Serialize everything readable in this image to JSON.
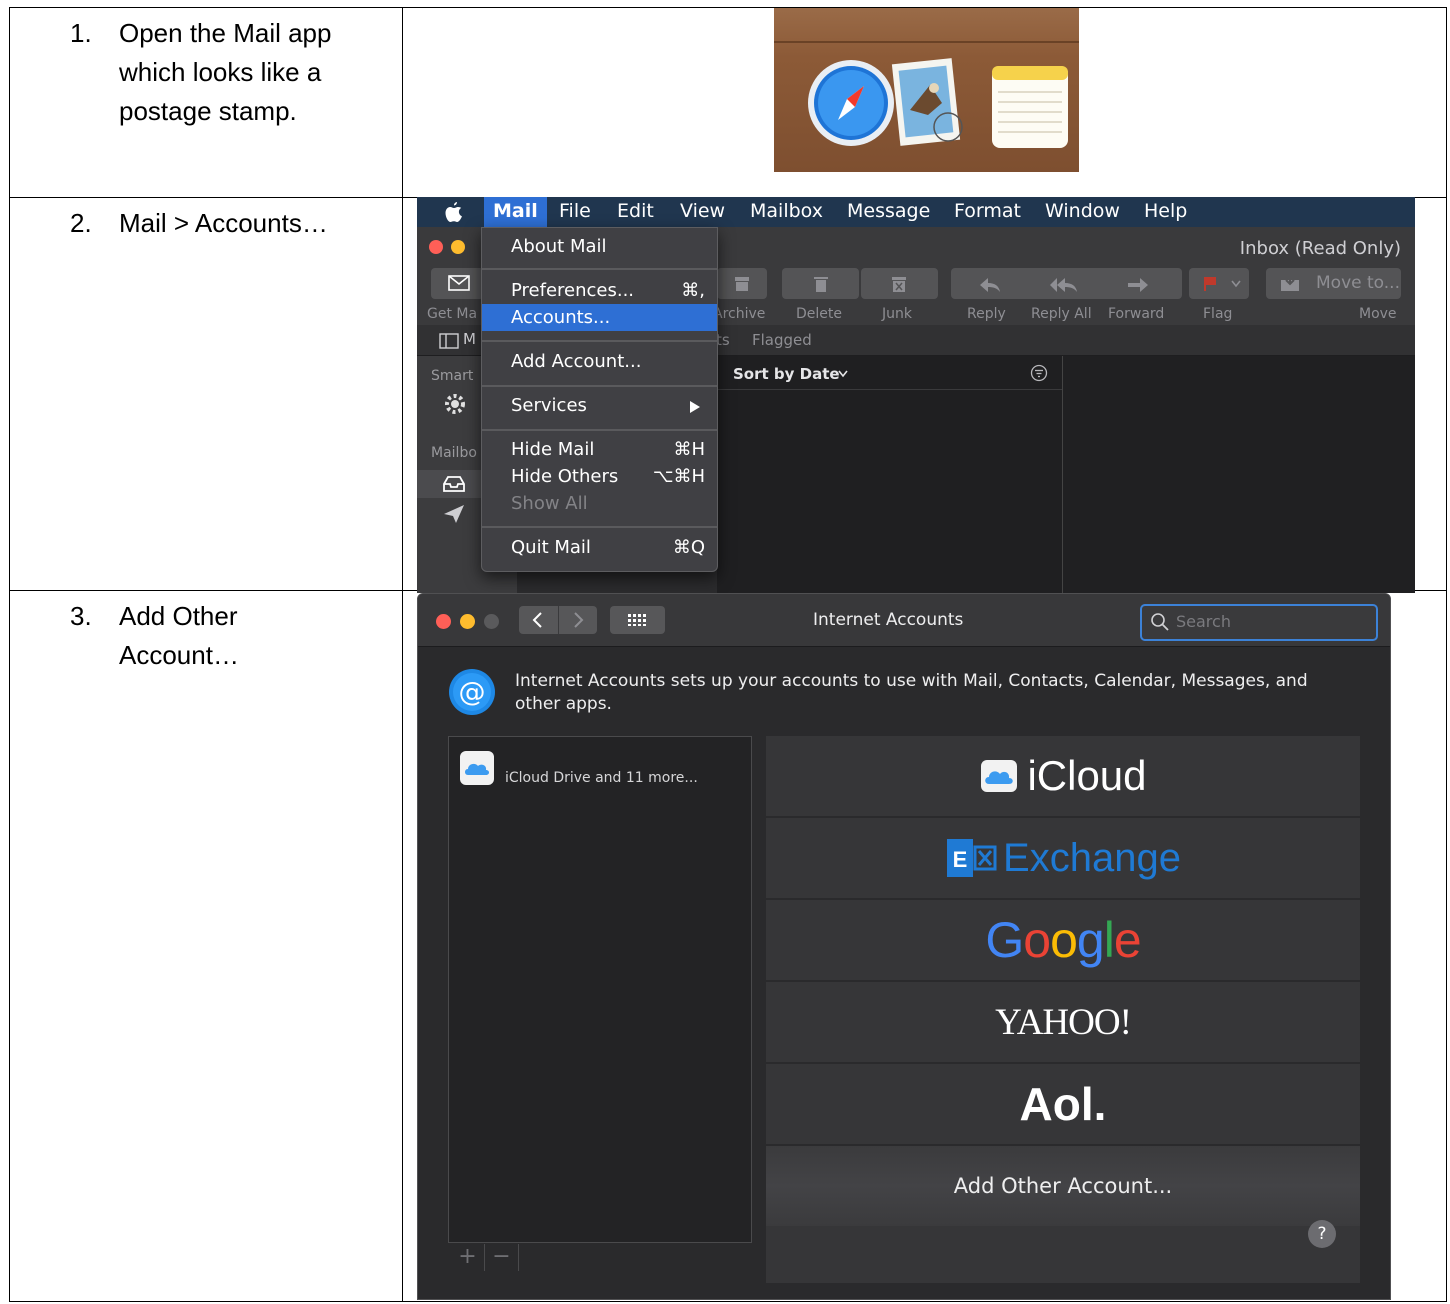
{
  "steps": [
    {
      "num": "1.",
      "text": "Open the Mail app which looks like a postage stamp."
    },
    {
      "num": "2.",
      "text": "Mail > Accounts…"
    },
    {
      "num": "3.",
      "text": "Add Other Account…"
    }
  ],
  "mail_screenshot": {
    "menubar": [
      "Mail",
      "File",
      "Edit",
      "View",
      "Mailbox",
      "Message",
      "Format",
      "Window",
      "Help"
    ],
    "window_title": "Inbox (Read Only)",
    "toolbar_labels": {
      "get_mail": "Get Ma",
      "archive": "Archive",
      "delete": "Delete",
      "junk": "Junk",
      "reply": "Reply",
      "reply_all": "Reply All",
      "forward": "Forward",
      "flag": "Flag",
      "move": "Move",
      "move_to": "Move to..."
    },
    "favorites_bar": {
      "mailboxes": "M",
      "fragment": "ts",
      "flagged": "Flagged"
    },
    "sidebar": {
      "smart": "Smart",
      "mailboxes": "Mailbo"
    },
    "sort_label": "Sort by Date",
    "menu": {
      "about": "About Mail",
      "preferences": "Preferences...",
      "preferences_shortcut": "⌘,",
      "accounts": "Accounts...",
      "add_account": "Add Account...",
      "services": "Services",
      "hide": "Hide Mail",
      "hide_shortcut": "⌘H",
      "hide_others": "Hide Others",
      "hide_others_shortcut": "⌥⌘H",
      "show_all": "Show All",
      "quit": "Quit Mail",
      "quit_shortcut": "⌘Q"
    }
  },
  "accounts_screenshot": {
    "title": "Internet Accounts",
    "search_placeholder": "Search",
    "description": "Internet Accounts sets up your accounts to use with Mail, Contacts, Calendar, Messages, and other apps.",
    "account_item": "iCloud Drive and 11 more...",
    "providers": {
      "icloud": "iCloud",
      "exchange": "Exchange",
      "google_letters": [
        "G",
        "o",
        "o",
        "g",
        "l",
        "e"
      ],
      "yahoo": "YAHOO!",
      "aol": "Aol."
    },
    "add_other": "Add Other Account...",
    "help": "?",
    "colors": {
      "google": [
        "#4285f4",
        "#ea4335",
        "#fbbc05",
        "#4285f4",
        "#34a853",
        "#ea4335"
      ],
      "exchange": "#1f7ad4",
      "highlight": "#2e6fd4"
    }
  }
}
